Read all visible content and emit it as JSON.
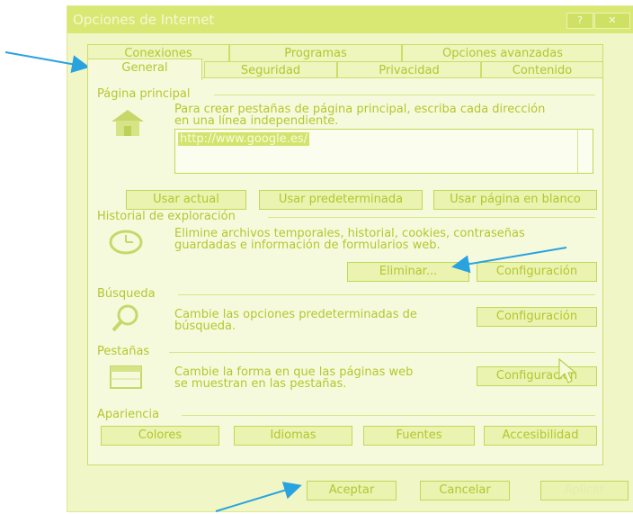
{
  "window": {
    "title": "Opciones de Internet",
    "help_label": "?",
    "close_label": "✕"
  },
  "tabs_row1": [
    "Conexiones",
    "Programas",
    "Opciones avanzadas"
  ],
  "tabs_row2": [
    "General",
    "Seguridad",
    "Privacidad",
    "Contenido"
  ],
  "home": {
    "heading": "Página principal",
    "desc_line1": "Para crear pestañas de página principal, escriba cada dirección",
    "desc_line2": "en una línea independiente.",
    "url": "http://www.google.es/",
    "btn_current": "Usar actual",
    "btn_default": "Usar predeterminada",
    "btn_blank": "Usar página en blanco"
  },
  "history": {
    "heading": "Historial de exploración",
    "desc_line1": "Elimine archivos temporales, historial, cookies, contraseñas",
    "desc_line2": "guardadas e información de formularios web.",
    "btn_delete": "Eliminar...",
    "btn_settings": "Configuración"
  },
  "search": {
    "heading": "Búsqueda",
    "desc_line1": "Cambie las opciones predeterminadas de",
    "desc_line2": "búsqueda.",
    "btn_settings": "Configuración"
  },
  "tabs_section": {
    "heading": "Pestañas",
    "desc_line1": "Cambie la forma en que las páginas web",
    "desc_line2": "se muestran en las pestañas.",
    "btn_settings": "Configuración"
  },
  "appearance": {
    "heading": "Apariencia",
    "btn_colors": "Colores",
    "btn_languages": "Idiomas",
    "btn_fonts": "Fuentes",
    "btn_accessibility": "Accesibilidad"
  },
  "footer": {
    "ok": "Aceptar",
    "cancel": "Cancelar",
    "apply": "Aplicar"
  },
  "colors": {
    "text": "#b3c72e",
    "arrow": "#29a3e0"
  }
}
